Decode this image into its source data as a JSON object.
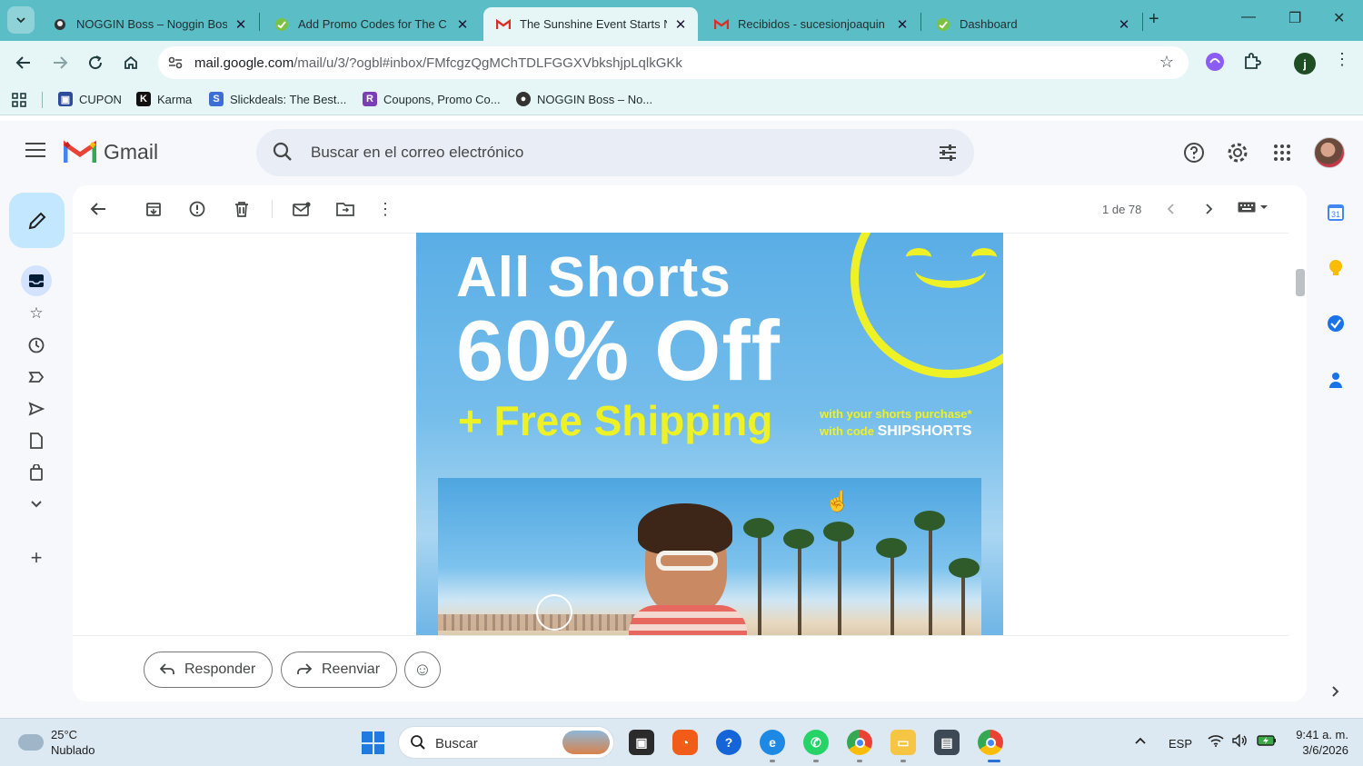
{
  "browser": {
    "tabs": [
      {
        "title": "NOGGIN Boss – Noggin Bos",
        "active": false
      },
      {
        "title": "Add Promo Codes for The C",
        "active": false
      },
      {
        "title": "The Sunshine Event Starts N",
        "active": true
      },
      {
        "title": "Recibidos - sucesionjoaquin",
        "active": false
      },
      {
        "title": "Dashboard",
        "active": false
      }
    ],
    "url_host": "mail.google.com",
    "url_path": "/mail/u/3/?ogbl#inbox/FMfcgzQgMChTDLFGGXVbkshjpLqlkGKk",
    "profile_initial": "j",
    "bookmarks": [
      "CUPON",
      "Karma",
      "Slickdeals: The Best...",
      "Coupons, Promo Co...",
      "NOGGIN Boss – No..."
    ]
  },
  "gmail": {
    "logo_text": "Gmail",
    "search_placeholder": "Buscar en el correo electrónico",
    "pager": "1 de 78",
    "promo": {
      "line1": "All Shorts",
      "line2": "60% Off",
      "line3": "+ Free Shipping",
      "small1": "with your shorts purchase*",
      "small2_prefix": "with code",
      "code": "SHIPSHORTS"
    },
    "reply_label": "Responder",
    "forward_label": "Reenviar",
    "calendar_day": "31"
  },
  "taskbar": {
    "temperature": "25°C",
    "condition": "Nublado",
    "search_label": "Buscar",
    "language": "ESP",
    "time": "9:41 a. m.",
    "date": "3/6/2026"
  },
  "colors": {
    "tabbar": "#5bbec7",
    "promo_yellow": "#eef125",
    "promo_blue": "#5aaee6"
  }
}
